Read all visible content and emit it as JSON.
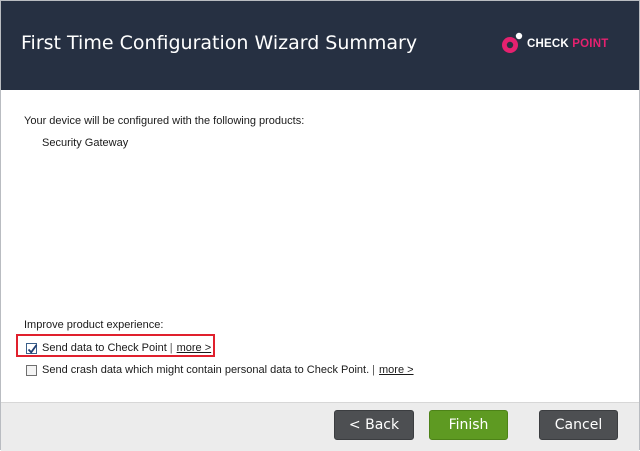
{
  "header": {
    "title": "First Time Configuration Wizard Summary",
    "logo": {
      "name": "check-point-logo",
      "text_primary": "CHECK ",
      "text_accent": "POINT",
      "accent_color": "#e5216f"
    }
  },
  "content": {
    "intro": "Your device will be configured with the following products:",
    "products": [
      "Security Gateway"
    ],
    "improve_label": "Improve product experience:",
    "options": [
      {
        "label": "Send data to Check Point",
        "separator": "|",
        "more": "more >",
        "checked": true
      },
      {
        "label": "Send crash data which might contain personal data to Check Point.",
        "separator": "|",
        "more": "more >",
        "checked": false
      }
    ]
  },
  "footer": {
    "back_label": "< Back",
    "finish_label": "Finish",
    "cancel_label": "Cancel"
  },
  "colors": {
    "header_bg": "#263042",
    "finish_bg": "#5e9a22",
    "button_bg": "#4d4f52",
    "highlight": "#e0202d"
  }
}
